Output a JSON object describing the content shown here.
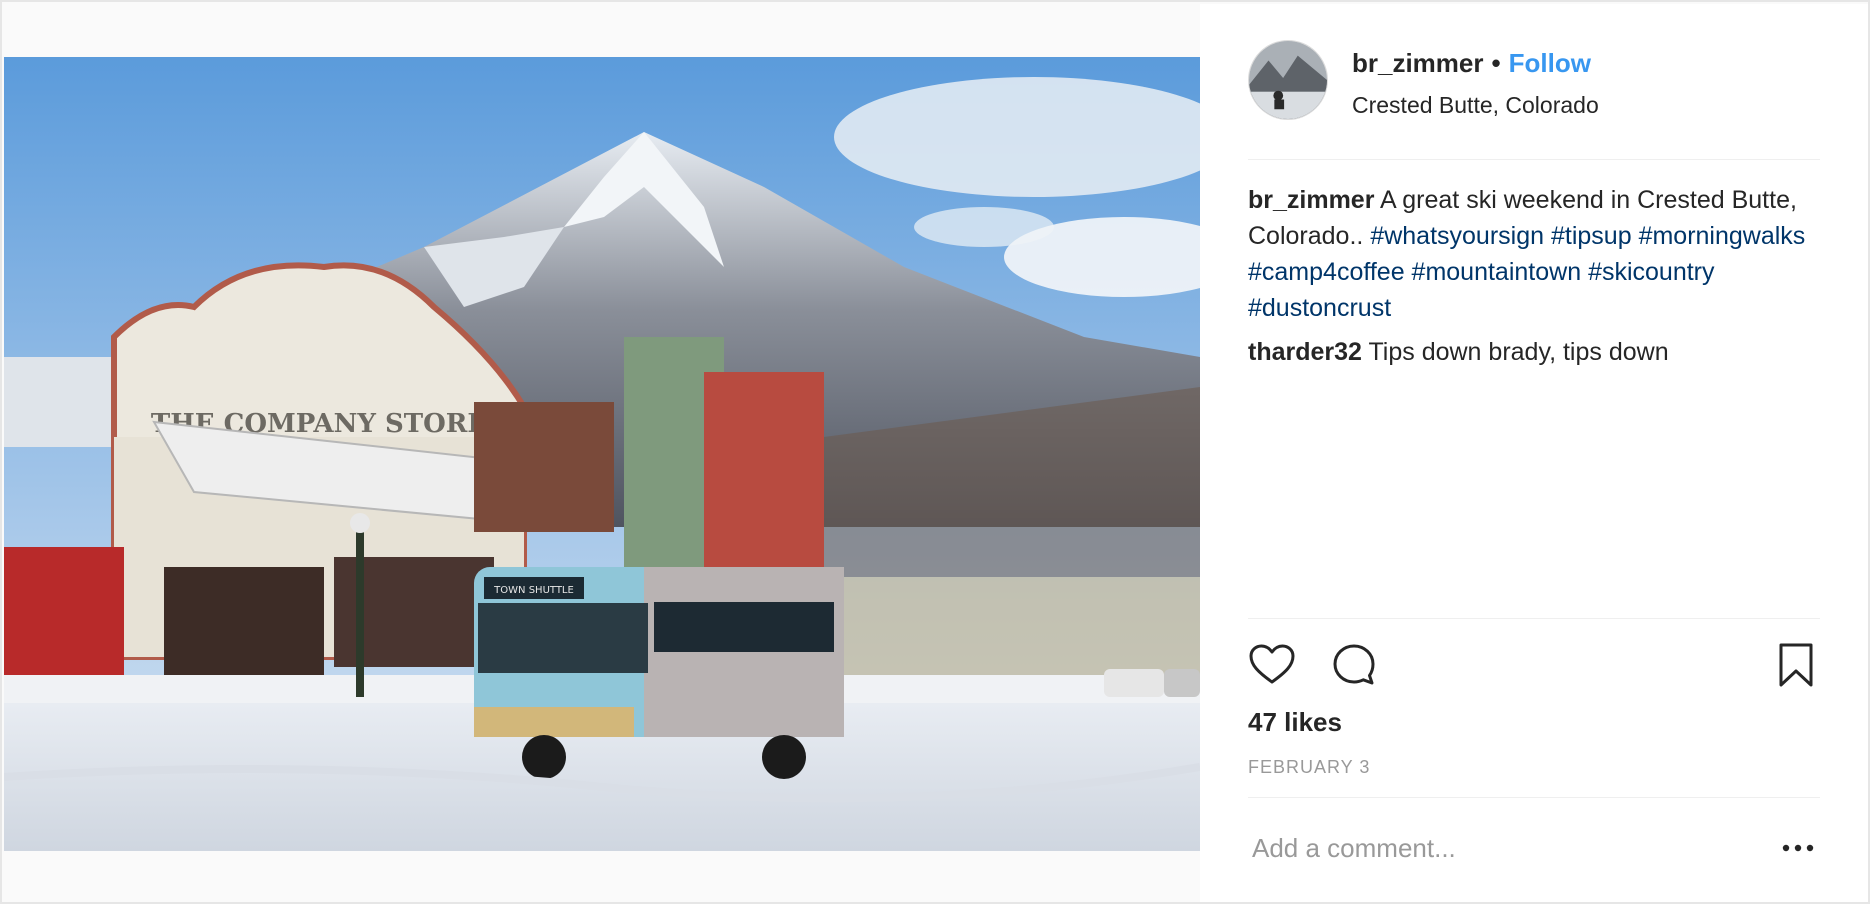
{
  "post": {
    "username": "br_zimmer",
    "follow_label": "Follow",
    "separator": "•",
    "location": "Crested Butte, Colorado"
  },
  "photo": {
    "storefront_sign": "THE COMPANY STORE",
    "bus_sign": "TOWN SHUTTLE"
  },
  "caption": {
    "username": "br_zimmer",
    "text": "A great ski weekend in Crested Butte, Colorado..",
    "hashtags": [
      "#whatsyoursign",
      "#tipsup",
      "#morningwalks",
      "#camp4coffee",
      "#mountaintown",
      "#skicountry",
      "#dustoncrust"
    ]
  },
  "comments": [
    {
      "username": "tharder32",
      "text": "Tips down brady, tips down"
    }
  ],
  "stats": {
    "likes": "47 likes",
    "date": "FEBRUARY 3"
  },
  "actions": {
    "like_icon": "heart-icon",
    "comment_icon": "speech-bubble-icon",
    "save_icon": "bookmark-icon"
  },
  "add_comment": {
    "placeholder": "Add a comment...",
    "more_icon": "ellipsis-icon"
  },
  "colors": {
    "follow": "#3897f0",
    "hashtag": "#003569",
    "muted": "#999999",
    "text": "#262626"
  }
}
